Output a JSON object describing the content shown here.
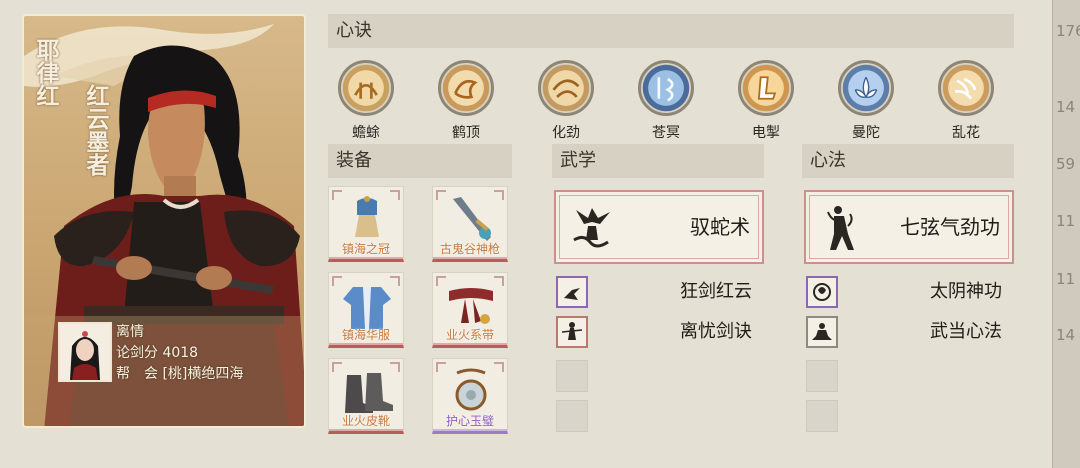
{
  "character": {
    "name": "耶律红",
    "title": "红云墨者",
    "partner": {
      "name": "离情",
      "score_label": "论剑分",
      "score": "4018",
      "guild_label": "帮　会",
      "guild": "[桃]横绝四海"
    }
  },
  "sections": {
    "heart": "心诀",
    "equipment": "装备",
    "martial": "武学",
    "inner": "心法"
  },
  "heart_skills": [
    {
      "label": "蟾蜍",
      "icon": "toad-icon"
    },
    {
      "label": "鹤顶",
      "icon": "crane-icon"
    },
    {
      "label": "化劲",
      "icon": "swirl-force-icon"
    },
    {
      "label": "苍冥",
      "icon": "dark-sky-icon"
    },
    {
      "label": "电掣",
      "icon": "lightning-icon"
    },
    {
      "label": "曼陀",
      "icon": "lotus-icon"
    },
    {
      "label": "乱花",
      "icon": "petals-icon"
    }
  ],
  "equipment": [
    {
      "label": "镇海之冠",
      "icon": "helmet-icon",
      "quality": "red"
    },
    {
      "label": "古鬼谷神枪",
      "icon": "spear-icon",
      "quality": "red"
    },
    {
      "label": "镇海华服",
      "icon": "robe-icon",
      "quality": "red"
    },
    {
      "label": "业火系带",
      "icon": "belt-icon",
      "quality": "red"
    },
    {
      "label": "业火皮靴",
      "icon": "boots-icon",
      "quality": "red"
    },
    {
      "label": "护心玉璧",
      "icon": "jade-amulet-icon",
      "quality": "purple"
    }
  ],
  "martial": {
    "main": "驭蛇术",
    "subs": [
      {
        "label": "狂剑红云",
        "quality": "purple"
      },
      {
        "label": "离忧剑诀",
        "quality": "red"
      }
    ]
  },
  "inner": {
    "main": "七弦气劲功",
    "subs": [
      {
        "label": "太阴神功",
        "quality": "purple"
      },
      {
        "label": "武当心法",
        "quality": "gray"
      }
    ]
  },
  "side_numbers": [
    "176",
    "14",
    "59",
    "11",
    "11",
    "14"
  ],
  "colors": {
    "background": "#e4e0d4",
    "card": "#c9a46f",
    "quality_red": "#b85c5c",
    "quality_purple": "#9b7cc6",
    "equip_label": "#c67a3e"
  }
}
